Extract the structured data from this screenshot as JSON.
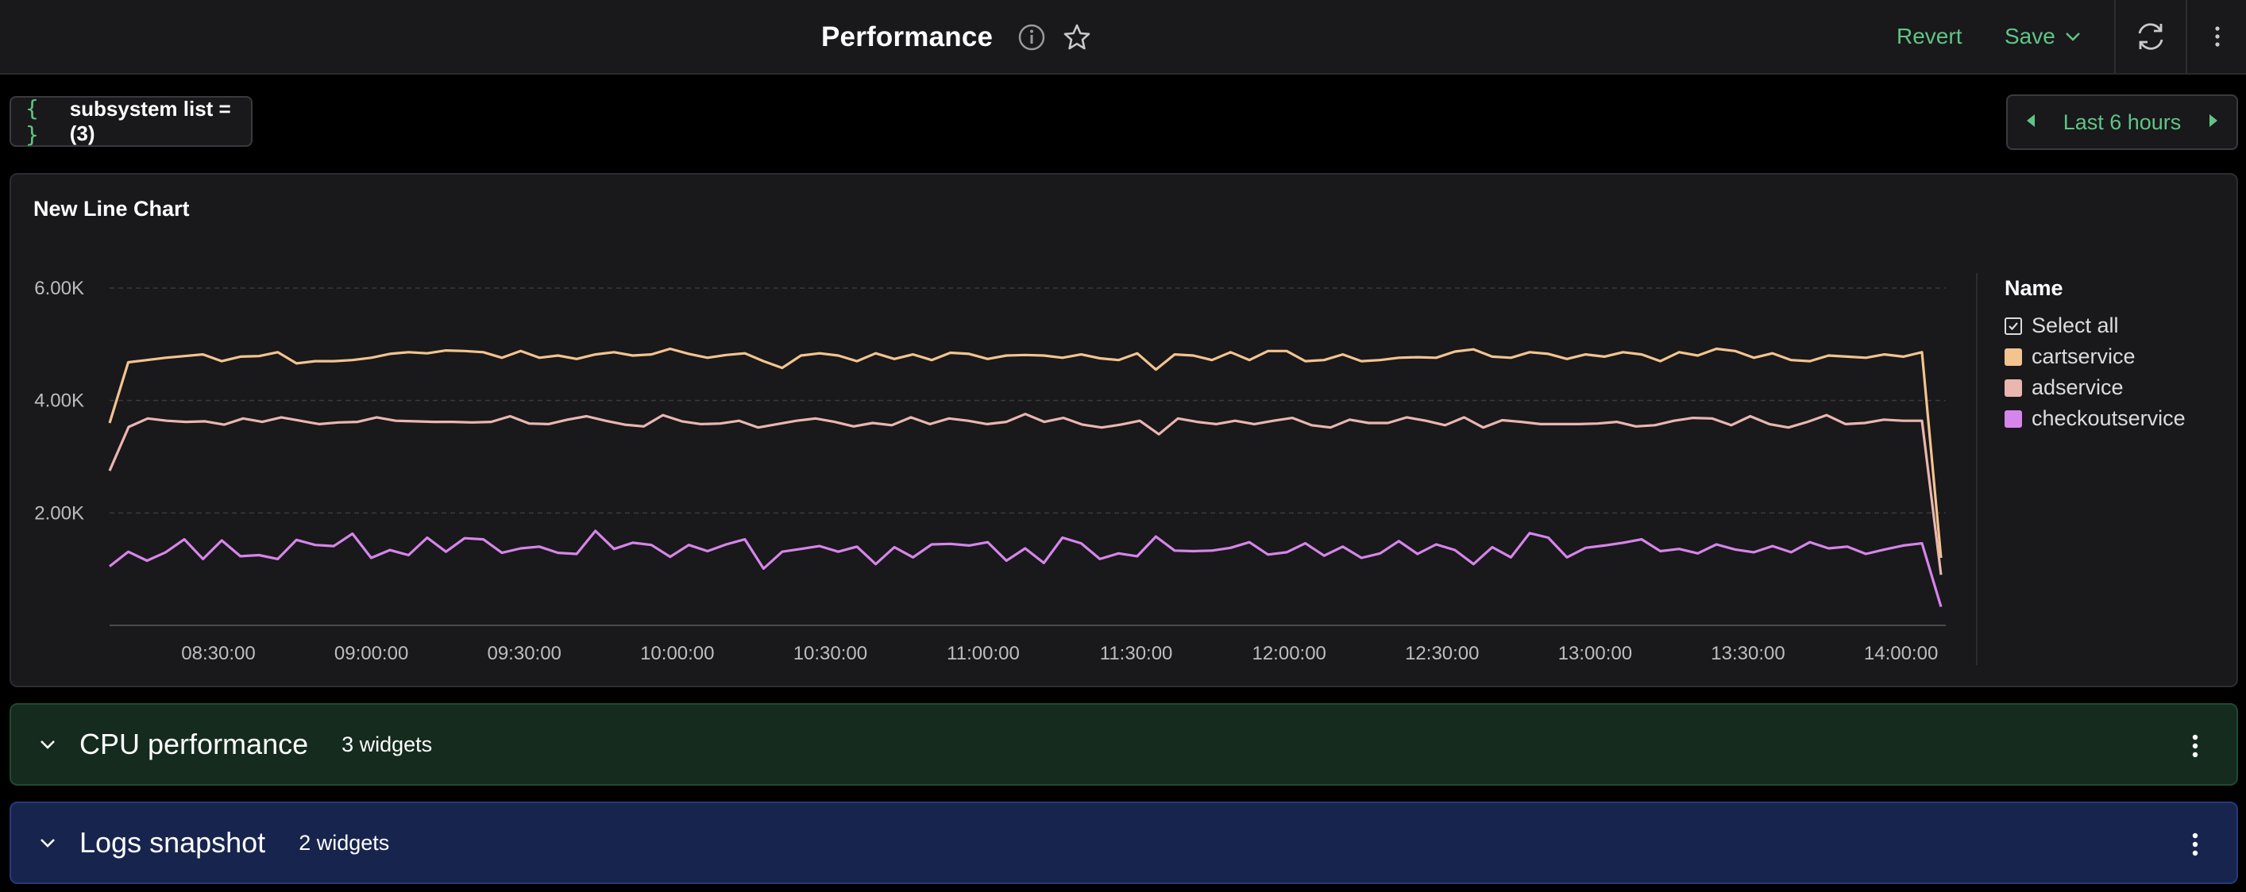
{
  "header": {
    "title": "Performance",
    "revert_label": "Revert",
    "save_label": "Save",
    "icons": [
      "info-icon",
      "star-icon",
      "chevron-down-icon",
      "refresh-icon",
      "more-vertical-icon"
    ]
  },
  "variables": {
    "chip_label": "subsystem list = (3)",
    "chip_icon": "{ }"
  },
  "time_range": {
    "label": "Last 6 hours"
  },
  "chart_panel": {
    "title": "New Line Chart"
  },
  "legend": {
    "header": "Name",
    "select_all_label": "Select all",
    "items": [
      {
        "label": "cartservice",
        "color": "#f3c48f"
      },
      {
        "label": "adservice",
        "color": "#eab6b0"
      },
      {
        "label": "checkoutservice",
        "color": "#d685ea"
      }
    ]
  },
  "chart_data": {
    "type": "line",
    "title": "New Line Chart",
    "xlabel": "",
    "ylabel": "",
    "ylim": [
      0,
      6000
    ],
    "yticks": [
      "2.00K",
      "4.00K",
      "6.00K"
    ],
    "ytick_values": [
      2000,
      4000,
      6000
    ],
    "xticks": [
      "08:30:00",
      "09:00:00",
      "09:30:00",
      "10:00:00",
      "10:30:00",
      "11:00:00",
      "11:30:00",
      "12:00:00",
      "12:30:00",
      "13:00:00",
      "13:30:00",
      "14:00:00"
    ],
    "legend_title": "Name",
    "legend_position": "right",
    "grid": true,
    "series": [
      {
        "name": "cartservice",
        "color": "#f3c48f",
        "values": [
          3600,
          4680,
          4720,
          4760,
          4790,
          4820,
          4700,
          4780,
          4790,
          4860,
          4660,
          4700,
          4700,
          4720,
          4760,
          4830,
          4860,
          4840,
          4890,
          4880,
          4860,
          4760,
          4880,
          4760,
          4800,
          4740,
          4820,
          4860,
          4800,
          4820,
          4920,
          4830,
          4760,
          4810,
          4840,
          4700,
          4580,
          4800,
          4840,
          4800,
          4700,
          4840,
          4740,
          4820,
          4720,
          4850,
          4830,
          4740,
          4800,
          4810,
          4800,
          4760,
          4820,
          4750,
          4720,
          4840,
          4550,
          4820,
          4800,
          4720,
          4860,
          4720,
          4880,
          4880,
          4700,
          4720,
          4820,
          4700,
          4720,
          4760,
          4770,
          4760,
          4870,
          4910,
          4780,
          4760,
          4860,
          4830,
          4740,
          4820,
          4780,
          4860,
          4820,
          4700,
          4860,
          4800,
          4920,
          4880,
          4760,
          4840,
          4720,
          4700,
          4800,
          4780,
          4760,
          4820,
          4780,
          4860,
          1200
        ]
      },
      {
        "name": "adservice",
        "color": "#eab6b0",
        "values": [
          2750,
          3530,
          3680,
          3640,
          3620,
          3630,
          3570,
          3680,
          3620,
          3700,
          3640,
          3580,
          3610,
          3620,
          3700,
          3640,
          3630,
          3620,
          3620,
          3610,
          3620,
          3720,
          3590,
          3580,
          3660,
          3720,
          3640,
          3570,
          3540,
          3740,
          3630,
          3580,
          3590,
          3640,
          3520,
          3580,
          3640,
          3680,
          3620,
          3540,
          3600,
          3560,
          3700,
          3580,
          3680,
          3640,
          3580,
          3620,
          3760,
          3620,
          3690,
          3570,
          3520,
          3570,
          3640,
          3400,
          3680,
          3620,
          3580,
          3640,
          3580,
          3640,
          3690,
          3560,
          3520,
          3660,
          3600,
          3600,
          3700,
          3640,
          3560,
          3700,
          3520,
          3650,
          3620,
          3580,
          3580,
          3580,
          3590,
          3620,
          3540,
          3560,
          3640,
          3690,
          3680,
          3560,
          3720,
          3580,
          3520,
          3620,
          3740,
          3580,
          3600,
          3660,
          3640,
          3640,
          900
        ]
      },
      {
        "name": "checkoutservice",
        "color": "#d685ea",
        "values": [
          1050,
          1310,
          1150,
          1300,
          1530,
          1180,
          1510,
          1230,
          1250,
          1180,
          1520,
          1430,
          1410,
          1630,
          1200,
          1340,
          1250,
          1560,
          1310,
          1550,
          1530,
          1290,
          1370,
          1400,
          1290,
          1270,
          1680,
          1360,
          1470,
          1430,
          1220,
          1430,
          1320,
          1440,
          1530,
          1010,
          1310,
          1360,
          1410,
          1310,
          1400,
          1090,
          1390,
          1210,
          1440,
          1450,
          1420,
          1480,
          1150,
          1370,
          1110,
          1560,
          1460,
          1180,
          1280,
          1230,
          1580,
          1330,
          1320,
          1330,
          1380,
          1480,
          1260,
          1300,
          1460,
          1240,
          1400,
          1200,
          1280,
          1500,
          1270,
          1440,
          1340,
          1090,
          1390,
          1210,
          1640,
          1560,
          1210,
          1380,
          1420,
          1470,
          1530,
          1320,
          1360,
          1280,
          1440,
          1350,
          1300,
          1410,
          1300,
          1480,
          1370,
          1400,
          1270,
          1350,
          1420,
          1460,
          330
        ]
      }
    ]
  },
  "sections": [
    {
      "title": "CPU performance",
      "count_label": "3 widgets"
    },
    {
      "title": "Logs snapshot",
      "count_label": "2 widgets"
    }
  ]
}
